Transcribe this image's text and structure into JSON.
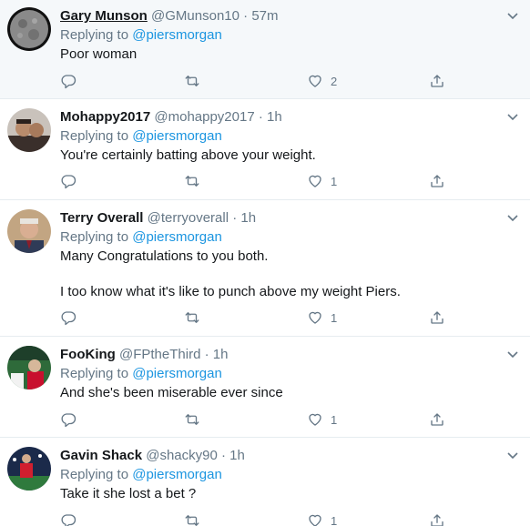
{
  "replying_label": "Replying to",
  "colors": {
    "accent": "#1b95e0",
    "muted": "#657786",
    "highlight_bg": "#f5f8fa",
    "divider": "#e6ecf0"
  },
  "icons": {
    "reply": "reply-icon",
    "retweet": "retweet-icon",
    "like": "like-icon",
    "share": "share-icon",
    "more": "chevron-down-icon"
  },
  "tweets": [
    {
      "name": "Gary Munson",
      "handle": "@GMunson10",
      "dot": "·",
      "time": "57m",
      "mention": "@piersmorgan",
      "text": [
        "Poor woman"
      ],
      "likes": "2"
    },
    {
      "name": "Mohappy2017",
      "handle": "@mohappy2017",
      "dot": "·",
      "time": "1h",
      "mention": "@piersmorgan",
      "text": [
        "You're certainly batting above your weight."
      ],
      "likes": "1"
    },
    {
      "name": "Terry Overall",
      "handle": "@terryoverall",
      "dot": "·",
      "time": "1h",
      "mention": "@piersmorgan",
      "text": [
        "Many Congratulations to you both.",
        "I too know what it's like to punch above my weight Piers."
      ],
      "likes": "1"
    },
    {
      "name": "FooKing",
      "handle": "@FPtheThird",
      "dot": "·",
      "time": "1h",
      "mention": "@piersmorgan",
      "text": [
        "And she's been miserable ever since"
      ],
      "likes": "1"
    },
    {
      "name": "Gavin Shack",
      "handle": "@shacky90",
      "dot": "·",
      "time": "1h",
      "mention": "@piersmorgan",
      "text": [
        "Take it she lost a bet ?"
      ],
      "likes": "1"
    }
  ]
}
